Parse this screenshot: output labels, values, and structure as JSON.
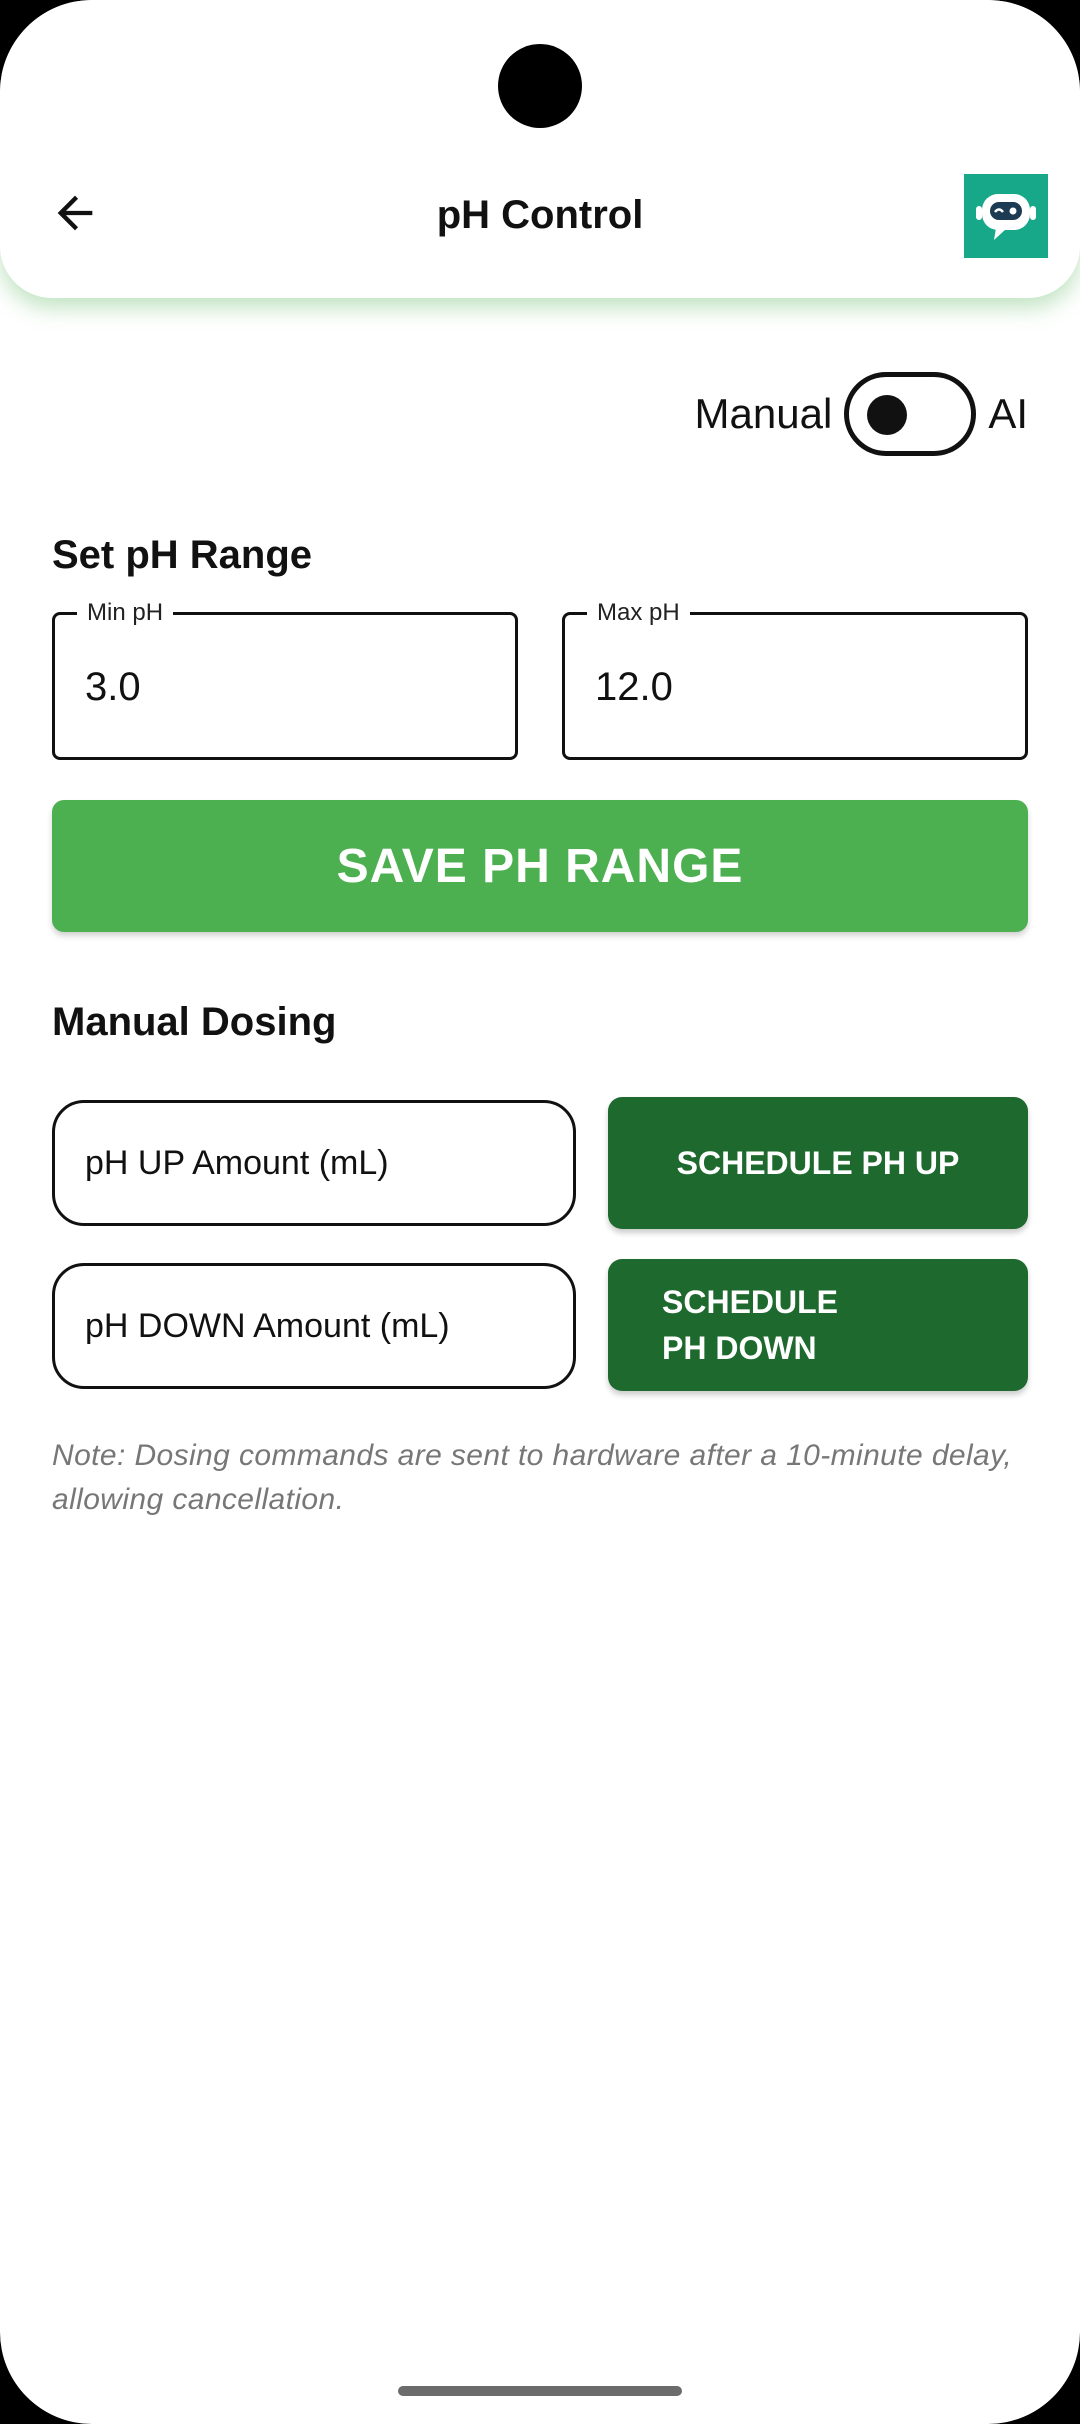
{
  "header": {
    "title": "pH Control",
    "back_icon": "arrow-left-icon",
    "assistant_icon": "robot-chat-icon",
    "assistant_color": "#17a88a"
  },
  "mode": {
    "left_label": "Manual",
    "right_label": "AI",
    "selected": "Manual"
  },
  "range": {
    "section_title": "Set pH Range",
    "min_label": "Min pH",
    "min_value": "3.0",
    "max_label": "Max pH",
    "max_value": "12.0",
    "save_label": "SAVE PH RANGE",
    "save_color": "#4caf50"
  },
  "dosing": {
    "section_title": "Manual Dosing",
    "up_placeholder": "pH UP Amount (mL)",
    "up_button": "SCHEDULE PH UP",
    "down_placeholder": "pH DOWN Amount (mL)",
    "down_button": "SCHEDULE PH DOWN",
    "button_color": "#1e6a2e",
    "note": "Note: Dosing commands are sent to hardware after a 10-minute delay, allowing cancellation."
  }
}
